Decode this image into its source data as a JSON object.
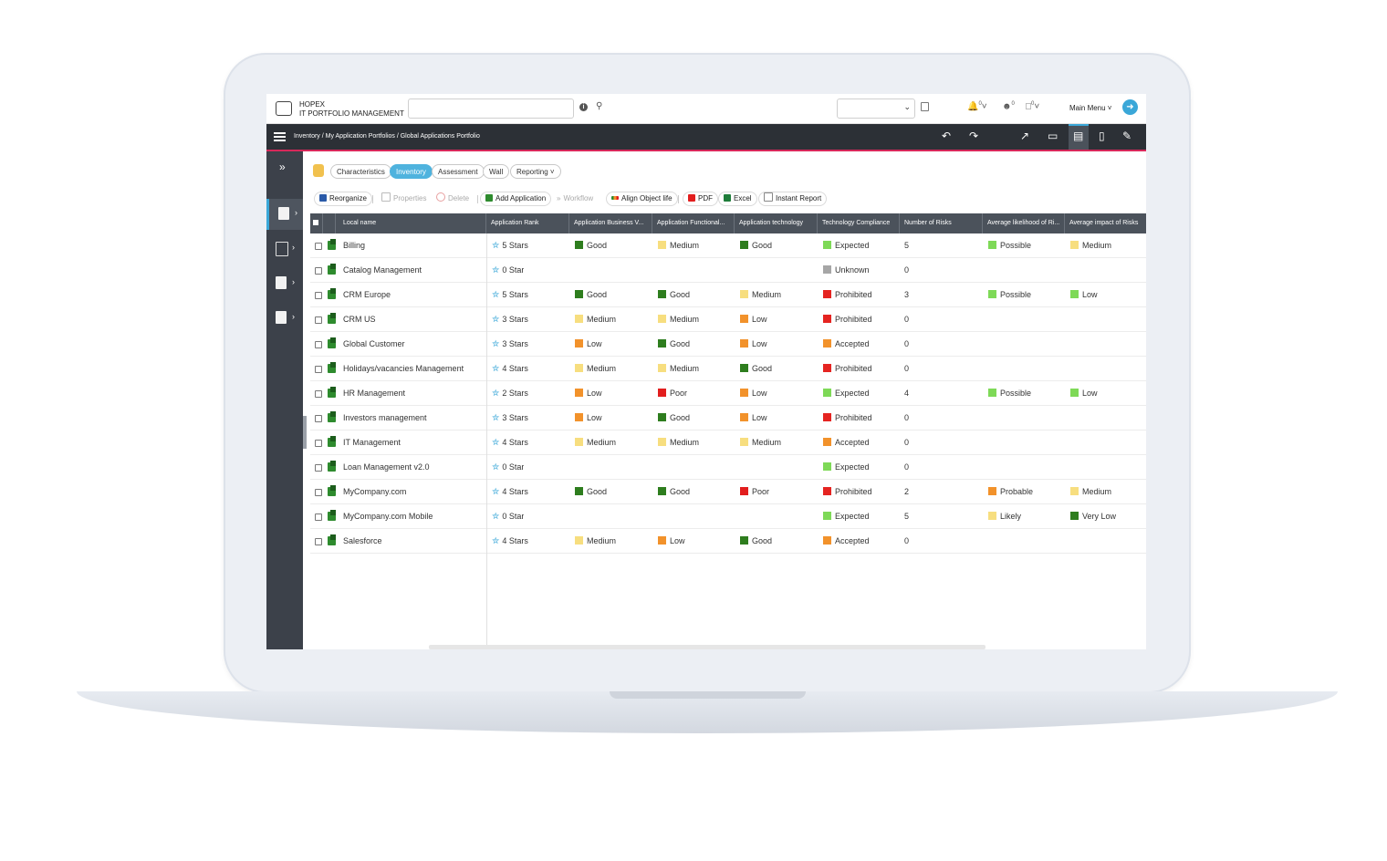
{
  "app": {
    "name": "HOPEX",
    "module": "IT PORTFOLIO MANAGEMENT"
  },
  "header": {
    "main_menu": "Main Menu",
    "notif_count": "0",
    "user_count": "0",
    "chat_count": "0"
  },
  "breadcrumb": "Inventory / My Application Portfolios / Global Applications Portfolio",
  "tabs": [
    {
      "label": "Characteristics",
      "active": false
    },
    {
      "label": "Inventory",
      "active": true
    },
    {
      "label": "Assessment",
      "active": false
    },
    {
      "label": "Wall",
      "active": false
    },
    {
      "label": "Reporting",
      "active": false
    }
  ],
  "toolbar": {
    "reorganize": "Reorganize",
    "properties": "Properties",
    "delete": "Delete",
    "add_application": "Add Application",
    "workflow": "Workflow",
    "align_object_life": "Align Object life",
    "pdf": "PDF",
    "excel": "Excel",
    "instant_report": "Instant Report"
  },
  "columns": [
    "Local name",
    "Application Rank",
    "Application Business V...",
    "Application Functional...",
    "Application technology",
    "Technology Compliance",
    "Number of Risks",
    "Average likelihood of Ri...",
    "Average impact of Risks"
  ],
  "colors": {
    "Good": "#2e7d1e",
    "Medium": "#f7de7f",
    "Low": "#f2922b",
    "Poor": "#e21e1e",
    "Expected": "#7ed957",
    "Unknown": "#a6a6a6",
    "Prohibited": "#e52421",
    "Accepted": "#f2922b",
    "Possible": "#7ed957",
    "Probable": "#f2922b",
    "Likely": "#f7de7f",
    "Very Low": "#2e7d1e",
    "ImpactLow": "#7ed957",
    "ImpactMedium": "#f7de7f"
  },
  "rows": [
    {
      "name": "Billing",
      "rank": "5 Stars",
      "business": "Good",
      "functional": "Medium",
      "technology": "Good",
      "compliance": "Expected",
      "risks": "5",
      "likelihood": "Possible",
      "impact": "Medium"
    },
    {
      "name": "Catalog Management",
      "rank": "0 Star",
      "business": "",
      "functional": "",
      "technology": "",
      "compliance": "Unknown",
      "risks": "0",
      "likelihood": "",
      "impact": ""
    },
    {
      "name": "CRM Europe",
      "rank": "5 Stars",
      "business": "Good",
      "functional": "Good",
      "technology": "Medium",
      "compliance": "Prohibited",
      "risks": "3",
      "likelihood": "Possible",
      "impact": "Low"
    },
    {
      "name": "CRM US",
      "rank": "3 Stars",
      "business": "Medium",
      "functional": "Medium",
      "technology": "Low",
      "compliance": "Prohibited",
      "risks": "0",
      "likelihood": "",
      "impact": ""
    },
    {
      "name": "Global Customer",
      "rank": "3 Stars",
      "business": "Low",
      "functional": "Good",
      "technology": "Low",
      "compliance": "Accepted",
      "risks": "0",
      "likelihood": "",
      "impact": ""
    },
    {
      "name": "Holidays/vacancies Management",
      "rank": "4 Stars",
      "business": "Medium",
      "functional": "Medium",
      "technology": "Good",
      "compliance": "Prohibited",
      "risks": "0",
      "likelihood": "",
      "impact": ""
    },
    {
      "name": "HR Management",
      "rank": "2 Stars",
      "business": "Low",
      "functional": "Poor",
      "technology": "Low",
      "compliance": "Expected",
      "risks": "4",
      "likelihood": "Possible",
      "impact": "Low"
    },
    {
      "name": "Investors management",
      "rank": "3 Stars",
      "business": "Low",
      "functional": "Good",
      "technology": "Low",
      "compliance": "Prohibited",
      "risks": "0",
      "likelihood": "",
      "impact": ""
    },
    {
      "name": "IT Management",
      "rank": "4 Stars",
      "business": "Medium",
      "functional": "Medium",
      "technology": "Medium",
      "compliance": "Accepted",
      "risks": "0",
      "likelihood": "",
      "impact": ""
    },
    {
      "name": "Loan Management v2.0",
      "rank": "0 Star",
      "business": "",
      "functional": "",
      "technology": "",
      "compliance": "Expected",
      "risks": "0",
      "likelihood": "",
      "impact": ""
    },
    {
      "name": "MyCompany.com",
      "rank": "4 Stars",
      "business": "Good",
      "functional": "Good",
      "technology": "Poor",
      "compliance": "Prohibited",
      "risks": "2",
      "likelihood": "Probable",
      "impact": "Medium"
    },
    {
      "name": "MyCompany.com Mobile",
      "rank": "0 Star",
      "business": "",
      "functional": "",
      "technology": "",
      "compliance": "Expected",
      "risks": "5",
      "likelihood": "Likely",
      "impact": "Very Low"
    },
    {
      "name": "Salesforce",
      "rank": "4 Stars",
      "business": "Medium",
      "functional": "Low",
      "technology": "Good",
      "compliance": "Accepted",
      "risks": "0",
      "likelihood": "",
      "impact": ""
    }
  ]
}
